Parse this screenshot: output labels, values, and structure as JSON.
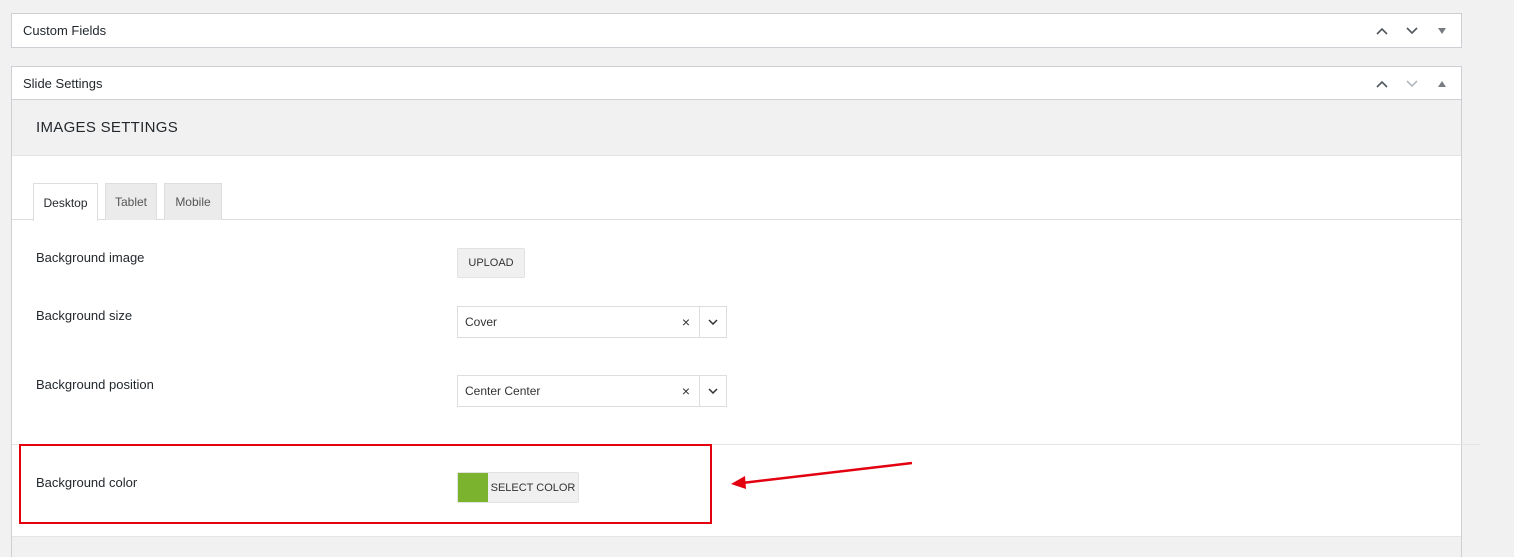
{
  "custom_fields": {
    "title": "Custom Fields"
  },
  "slide_settings": {
    "title": "Slide Settings",
    "section_title": "IMAGES SETTINGS",
    "tabs": [
      {
        "label": "Desktop",
        "active": true
      },
      {
        "label": "Tablet",
        "active": false
      },
      {
        "label": "Mobile",
        "active": false
      }
    ],
    "fields": {
      "background_image": {
        "label": "Background image",
        "button": "UPLOAD"
      },
      "background_size": {
        "label": "Background size",
        "value": "Cover"
      },
      "background_position": {
        "label": "Background position",
        "value": "Center Center"
      },
      "background_color": {
        "label": "Background color",
        "button": "SELECT COLOR",
        "swatch": "#7cb32e"
      }
    }
  },
  "icons": {
    "move_up": "chevron-up-icon",
    "move_down": "chevron-down-icon",
    "toggle_closed": "triangle-down-icon",
    "toggle_open": "triangle-up-icon",
    "clear": "x-icon",
    "dropdown": "chevron-down-icon"
  },
  "annotation": {
    "highlight_color": "#e3000f"
  }
}
